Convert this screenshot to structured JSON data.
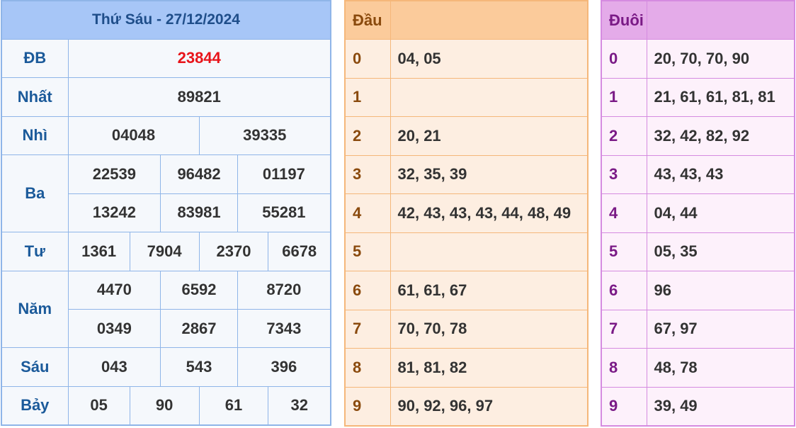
{
  "title": "Thứ Sáu - 27/12/2024",
  "prizes": {
    "db": {
      "label": "ĐB",
      "values": [
        "23844"
      ]
    },
    "nhat": {
      "label": "Nhất",
      "values": [
        "89821"
      ]
    },
    "nhi": {
      "label": "Nhì",
      "values": [
        "04048",
        "39335"
      ]
    },
    "ba": {
      "label": "Ba",
      "values": [
        "22539",
        "96482",
        "01197",
        "13242",
        "83981",
        "55281"
      ]
    },
    "tu": {
      "label": "Tư",
      "values": [
        "1361",
        "7904",
        "2370",
        "6678"
      ]
    },
    "nam": {
      "label": "Năm",
      "values": [
        "4470",
        "6592",
        "8720",
        "0349",
        "2867",
        "7343"
      ]
    },
    "sau": {
      "label": "Sáu",
      "values": [
        "043",
        "543",
        "396"
      ]
    },
    "bay": {
      "label": "Bảy",
      "values": [
        "05",
        "90",
        "61",
        "32"
      ]
    }
  },
  "dau": {
    "header": "Đầu",
    "rows": [
      {
        "digit": "0",
        "values": "04, 05"
      },
      {
        "digit": "1",
        "values": ""
      },
      {
        "digit": "2",
        "values": "20, 21"
      },
      {
        "digit": "3",
        "values": "32, 35, 39"
      },
      {
        "digit": "4",
        "values": "42, 43, 43, 43, 44, 48, 49"
      },
      {
        "digit": "5",
        "values": ""
      },
      {
        "digit": "6",
        "values": "61, 61, 67"
      },
      {
        "digit": "7",
        "values": "70, 70, 78"
      },
      {
        "digit": "8",
        "values": "81, 81, 82"
      },
      {
        "digit": "9",
        "values": "90, 92, 96, 97"
      }
    ]
  },
  "duoi": {
    "header": "Đuôi",
    "rows": [
      {
        "digit": "0",
        "values": "20, 70, 70, 90"
      },
      {
        "digit": "1",
        "values": "21, 61, 61, 81, 81"
      },
      {
        "digit": "2",
        "values": "32, 42, 82, 92"
      },
      {
        "digit": "3",
        "values": "43, 43, 43"
      },
      {
        "digit": "4",
        "values": "04, 44"
      },
      {
        "digit": "5",
        "values": "05, 35"
      },
      {
        "digit": "6",
        "values": "96"
      },
      {
        "digit": "7",
        "values": "67, 97"
      },
      {
        "digit": "8",
        "values": "48, 78"
      },
      {
        "digit": "9",
        "values": "39, 49"
      }
    ]
  }
}
